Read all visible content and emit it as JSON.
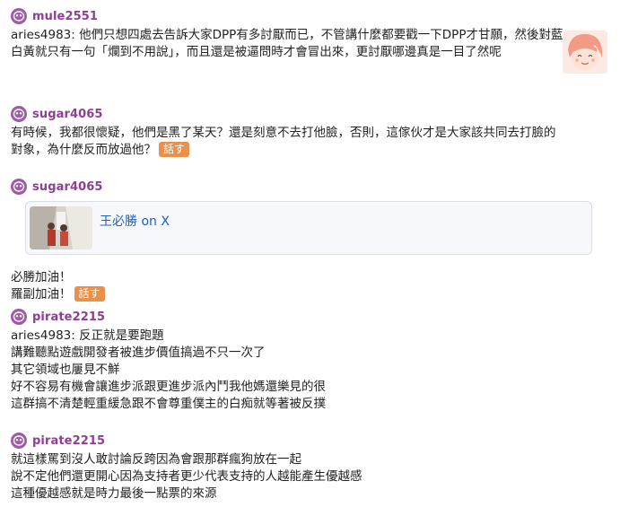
{
  "comments": [
    {
      "user": "mule2551",
      "lines": [
        "aries4983: 他們只想四處去告訴大家DPP有多討厭而已，不管講什麼都要戳一下DPP才甘願，然後對藍",
        "白黃就只有一句「爛到不用說」，而且還是被逼問時才會冒出來，更討厭哪邊真是一目了然呢"
      ]
    },
    {
      "user": "sugar4065",
      "lines": [
        "有時候，我都很懷疑，他們是黑了某天？還是刻意不去打他臉，否則，這傢伙才是大家該共同去打臉的",
        "對象，為什麼反而放過他？"
      ],
      "tag": "話す"
    },
    {
      "user": "sugar4065",
      "card_title": "王必勝 on X",
      "lines": [
        "必勝加油！",
        "羅副加油！"
      ],
      "tag": "話す"
    },
    {
      "user": "pirate2215",
      "lines": [
        "aries4983: 反正就是要跑題",
        "講難聽點遊戲開發者被進步價值搞過不只一次了",
        "其它領域也屢見不鮮",
        "好不容易有機會讓進步派跟更進步派內鬥我他媽還樂見的很",
        "這群搞不清楚輕重緩急跟不會尊重僕主的白痴就等著被反撲"
      ]
    },
    {
      "user": "pirate2215",
      "lines": [
        "就這樣罵到沒人敢討論反跨因為會跟那群瘋狗放在一起",
        "說不定他們還更開心因為支持者更少代表支持的人越能產生優越感",
        "這種優越感就是時力最後一點票的來源"
      ]
    }
  ],
  "colors": {
    "username": "#8e3f95",
    "avatar": "#a05aa6",
    "tag": "#e8914a",
    "link": "#1d5fbf"
  },
  "icons": {
    "avatar": "alien-face-icon"
  }
}
